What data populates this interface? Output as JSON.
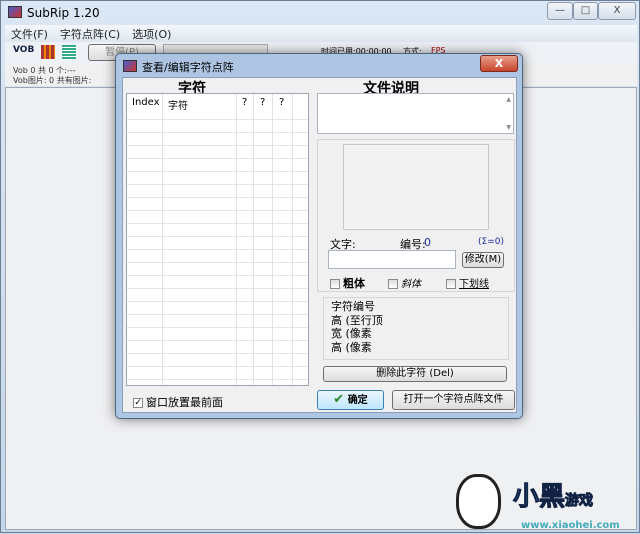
{
  "app": {
    "title": "SubRip 1.20",
    "min": "—",
    "max": "□",
    "close": "X"
  },
  "menu": [
    "文件(F)",
    "字符点阵(C)",
    "选项(O)"
  ],
  "toolbar": {
    "vob": "VOB",
    "pause": "暂停(P)",
    "time": "时间已用:00:00:00",
    "mode_label": "方式:",
    "mode": "FPS"
  },
  "status": {
    "line1": "Vob 0 共 0 个:---",
    "line2": "Vob图片: 0    共有图片:"
  },
  "dialog": {
    "title": "查看/编辑字符点阵",
    "close": "X",
    "left_header": "字符",
    "right_header": "文件说明",
    "columns": [
      "Index",
      "字符",
      "?",
      "?",
      "?"
    ],
    "text_label": "文字:",
    "number_label": "编号:",
    "number": "0",
    "sum": "(Σ=0)",
    "text_value": "",
    "modify": "修改(M)",
    "bold": "粗体",
    "italic": "斜体",
    "underline": "下划线",
    "info": [
      "字符编号",
      "高 (至行顶",
      "宽 (像素",
      "高 (像素"
    ],
    "delete": "删除此字符 (Del)",
    "topmost": "窗口放置最前面",
    "ok": "确定",
    "open": "打开一个字符点阵文件"
  },
  "watermark": {
    "text": "小黑游戏",
    "url": "www.xiaohei.com"
  }
}
